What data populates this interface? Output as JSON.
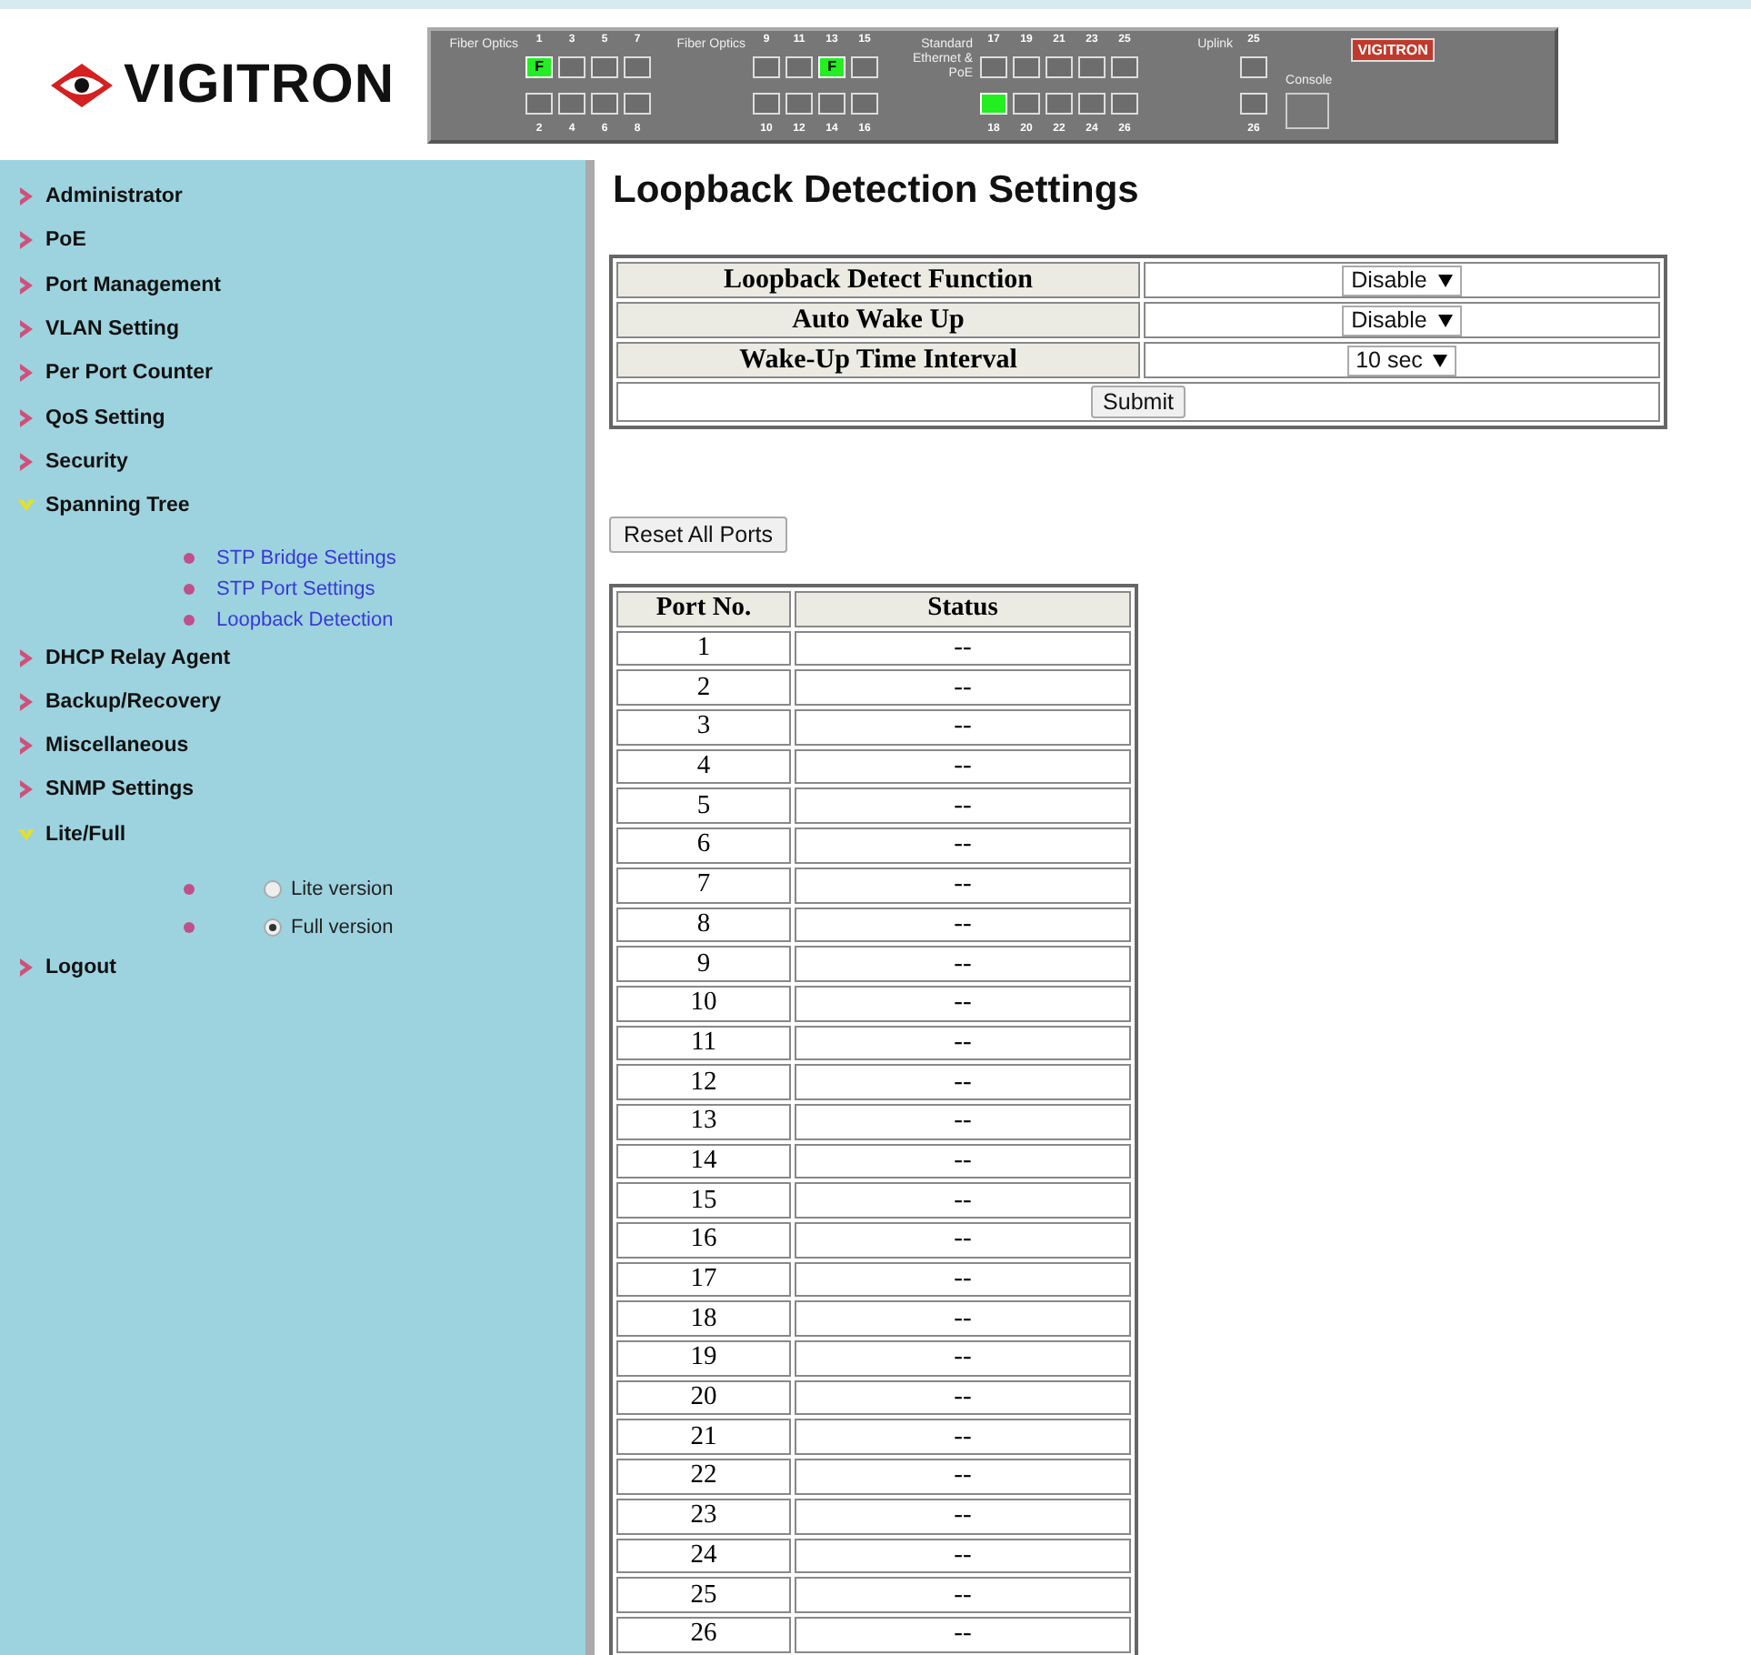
{
  "header": {
    "logo_text": "VIGITRON",
    "device_panel": {
      "groups": [
        {
          "label": "Fiber Optics",
          "columns": [
            {
              "top_number": "1",
              "top_port": {
                "active": true,
                "label": "F"
              },
              "bottom_number": "2",
              "bottom_port": {
                "active": false
              }
            },
            {
              "top_number": "3",
              "top_port": {
                "active": false
              },
              "bottom_number": "4",
              "bottom_port": {
                "active": false
              }
            },
            {
              "top_number": "5",
              "top_port": {
                "active": false
              },
              "bottom_number": "6",
              "bottom_port": {
                "active": false
              }
            },
            {
              "top_number": "7",
              "top_port": {
                "active": false
              },
              "bottom_number": "8",
              "bottom_port": {
                "active": false
              }
            }
          ]
        },
        {
          "label": "Fiber Optics",
          "columns": [
            {
              "top_number": "9",
              "top_port": {
                "active": false
              },
              "bottom_number": "10",
              "bottom_port": {
                "active": false
              }
            },
            {
              "top_number": "11",
              "top_port": {
                "active": false
              },
              "bottom_number": "12",
              "bottom_port": {
                "active": false
              }
            },
            {
              "top_number": "13",
              "top_port": {
                "active": true,
                "label": "F"
              },
              "bottom_number": "14",
              "bottom_port": {
                "active": false
              }
            },
            {
              "top_number": "15",
              "top_port": {
                "active": false
              },
              "bottom_number": "16",
              "bottom_port": {
                "active": false
              }
            }
          ]
        },
        {
          "label": "Standard Ethernet & PoE",
          "columns": [
            {
              "top_number": "17",
              "top_port": {
                "active": false
              },
              "bottom_number": "18",
              "bottom_port": {
                "active": true
              }
            },
            {
              "top_number": "19",
              "top_port": {
                "active": false
              },
              "bottom_number": "20",
              "bottom_port": {
                "active": false
              }
            },
            {
              "top_number": "21",
              "top_port": {
                "active": false
              },
              "bottom_number": "22",
              "bottom_port": {
                "active": false
              }
            },
            {
              "top_number": "23",
              "top_port": {
                "active": false
              },
              "bottom_number": "24",
              "bottom_port": {
                "active": false
              }
            },
            {
              "top_number": "25",
              "top_port": {
                "active": false
              },
              "bottom_number": "26",
              "bottom_port": {
                "active": false
              }
            }
          ]
        },
        {
          "label": "Uplink",
          "columns": [
            {
              "top_number": "25",
              "top_port": {
                "active": false
              },
              "bottom_number": "26",
              "bottom_port": {
                "active": false
              }
            }
          ]
        }
      ],
      "console_label": "Console",
      "badge_text": "VIGITRON"
    }
  },
  "sidebar": {
    "items": [
      {
        "label": "Administrator",
        "expanded": false
      },
      {
        "label": "PoE",
        "expanded": false
      },
      {
        "label": "Port Management",
        "expanded": false
      },
      {
        "label": "VLAN Setting",
        "expanded": false
      },
      {
        "label": "Per Port Counter",
        "expanded": false
      },
      {
        "label": "QoS Setting",
        "expanded": false
      },
      {
        "label": "Security",
        "expanded": false
      },
      {
        "label": "Spanning Tree",
        "expanded": true,
        "children": [
          {
            "kind": "link",
            "label": "STP Bridge Settings"
          },
          {
            "kind": "link",
            "label": "STP Port Settings"
          },
          {
            "kind": "link",
            "label": "Loopback Detection"
          }
        ]
      },
      {
        "label": "DHCP Relay Agent",
        "expanded": false
      },
      {
        "label": "Backup/Recovery",
        "expanded": false
      },
      {
        "label": "Miscellaneous",
        "expanded": false
      },
      {
        "label": "SNMP Settings",
        "expanded": false
      },
      {
        "label": "Lite/Full",
        "expanded": true,
        "children": [
          {
            "kind": "radio",
            "label": "Lite version",
            "selected": false
          },
          {
            "kind": "radio",
            "label": "Full version",
            "selected": true
          }
        ]
      },
      {
        "label": "Logout",
        "expanded": false
      }
    ]
  },
  "main": {
    "title": "Loopback Detection Settings",
    "settings": [
      {
        "label": "Loopback Detect Function",
        "value": "Disable"
      },
      {
        "label": "Auto Wake Up",
        "value": "Disable"
      },
      {
        "label": "Wake-Up Time Interval",
        "value": "10 sec"
      }
    ],
    "submit_button": "Submit",
    "reset_button": "Reset All Ports",
    "ports_table": {
      "columns": [
        "Port No.",
        "Status"
      ],
      "rows": [
        [
          "1",
          "--"
        ],
        [
          "2",
          "--"
        ],
        [
          "3",
          "--"
        ],
        [
          "4",
          "--"
        ],
        [
          "5",
          "--"
        ],
        [
          "6",
          "--"
        ],
        [
          "7",
          "--"
        ],
        [
          "8",
          "--"
        ],
        [
          "9",
          "--"
        ],
        [
          "10",
          "--"
        ],
        [
          "11",
          "--"
        ],
        [
          "12",
          "--"
        ],
        [
          "13",
          "--"
        ],
        [
          "14",
          "--"
        ],
        [
          "15",
          "--"
        ],
        [
          "16",
          "--"
        ],
        [
          "17",
          "--"
        ],
        [
          "18",
          "--"
        ],
        [
          "19",
          "--"
        ],
        [
          "20",
          "--"
        ],
        [
          "21",
          "--"
        ],
        [
          "22",
          "--"
        ],
        [
          "23",
          "--"
        ],
        [
          "24",
          "--"
        ],
        [
          "25",
          "--"
        ],
        [
          "26",
          "--"
        ]
      ]
    }
  }
}
